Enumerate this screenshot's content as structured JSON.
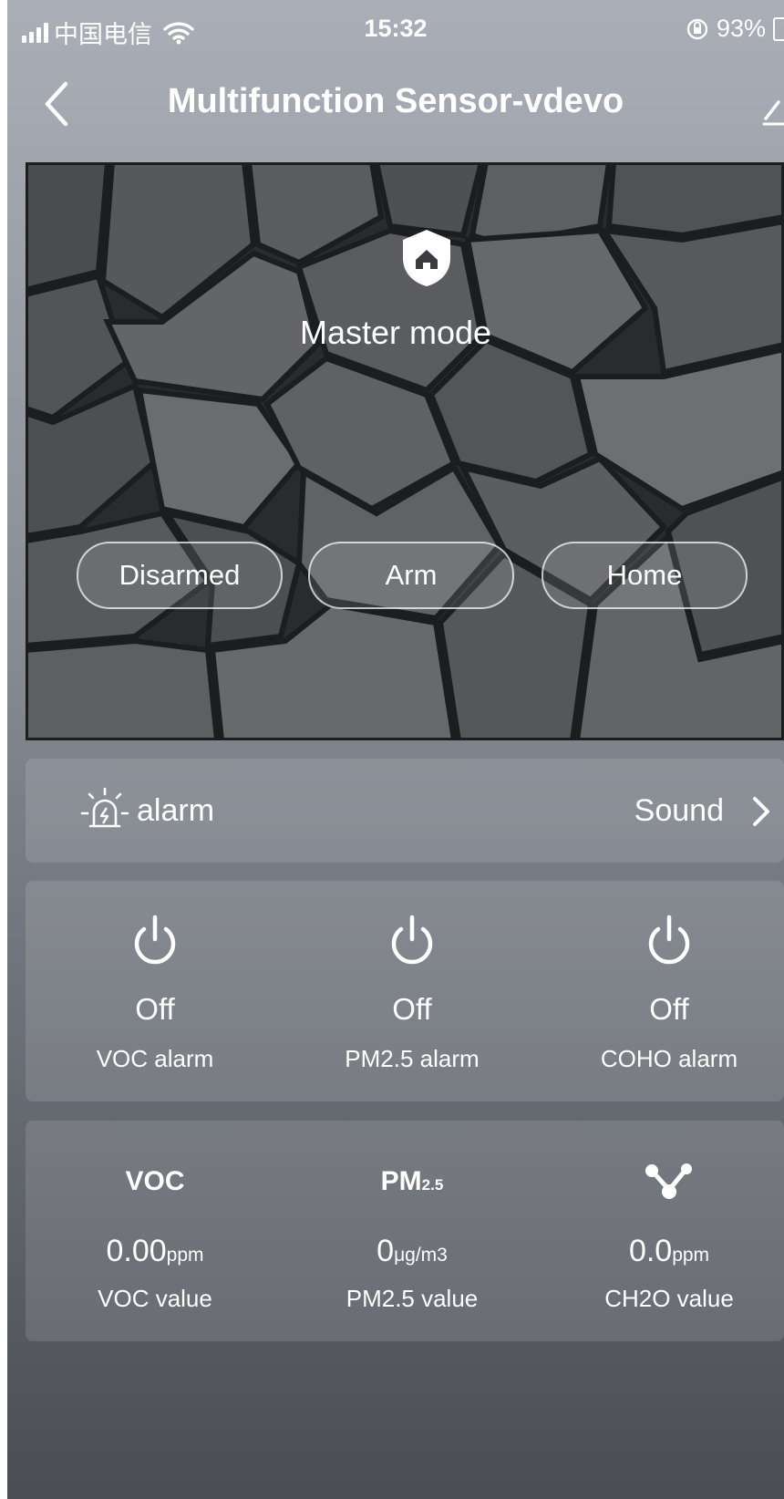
{
  "status_bar": {
    "carrier": "中国电信",
    "time": "15:32",
    "battery": "93%"
  },
  "nav": {
    "title": "Multifunction Sensor-vdevo"
  },
  "hero": {
    "mode_label": "Master mode",
    "buttons": [
      "Disarmed",
      "Arm",
      "Home"
    ]
  },
  "alarm": {
    "label": "alarm",
    "value": "Sound"
  },
  "switches": [
    {
      "state": "Off",
      "label": "VOC alarm"
    },
    {
      "state": "Off",
      "label": "PM2.5 alarm"
    },
    {
      "state": "Off",
      "label": "COHO alarm"
    }
  ],
  "values": {
    "voc": {
      "head": "VOC",
      "value": "0.00",
      "unit": "ppm",
      "label": "VOC value"
    },
    "pm25": {
      "head_main": "PM",
      "head_sub": "2.5",
      "value": "0",
      "unit": "μg/m3",
      "label": "PM2.5 value"
    },
    "ch2o": {
      "value": "0.0",
      "unit": "ppm",
      "label": "CH2O value"
    }
  }
}
